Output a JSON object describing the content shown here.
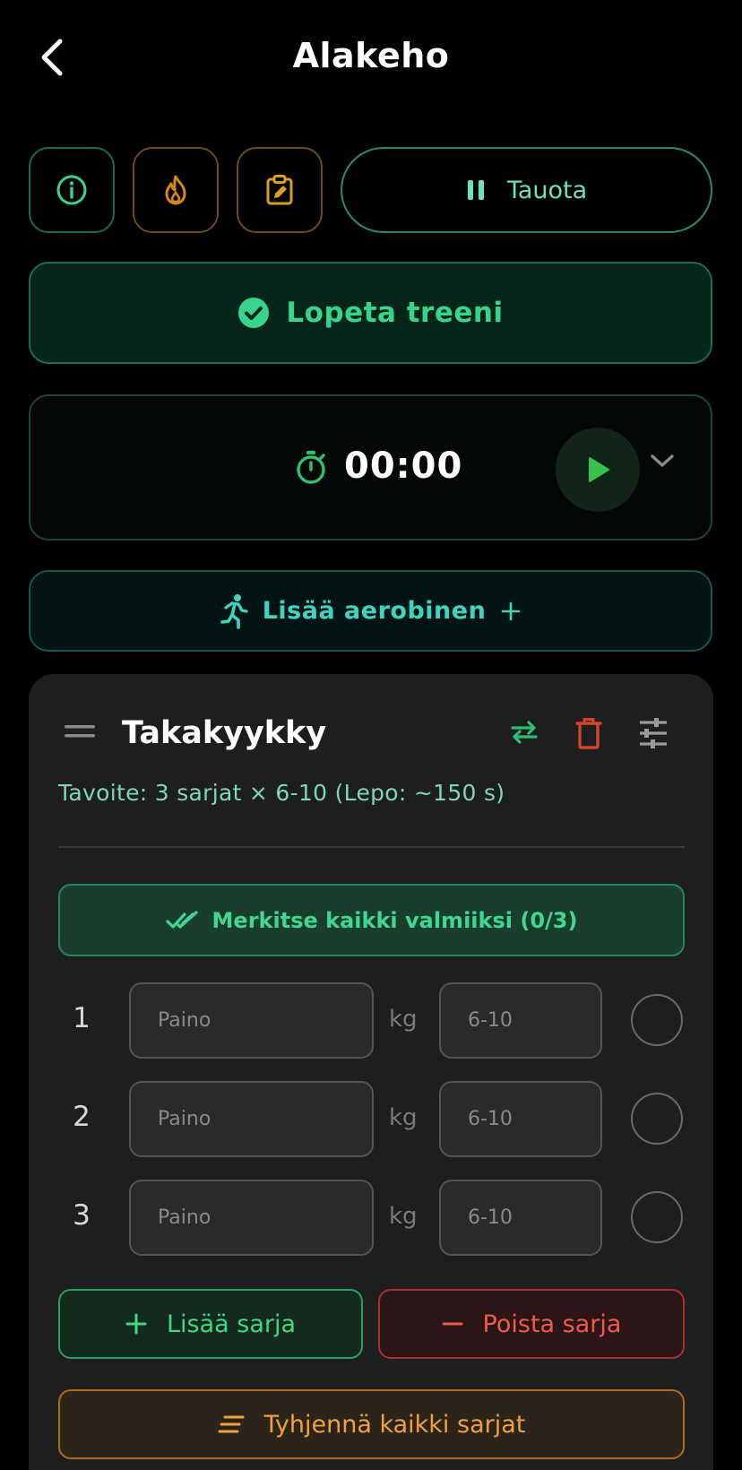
{
  "header": {
    "title": "Alakeho",
    "back_icon": "chevron-left-icon"
  },
  "toolbar": {
    "info_icon": "info-icon",
    "fire_icon": "flame-icon",
    "notes_icon": "clipboard-edit-icon",
    "pause_label": "Tauota"
  },
  "finish": {
    "label": "Lopeta treeni"
  },
  "timer": {
    "value": "00:00"
  },
  "aerobic": {
    "label": "Lisää aerobinen"
  },
  "exercise": {
    "name": "Takakyykky",
    "target": "Tavoite: 3 sarjat × 6-10 (Lepo: ~150 s)",
    "mark_all_label": "Merkitse kaikki valmiiksi (0/3)",
    "weight_unit": "kg",
    "sets": [
      {
        "number": "1",
        "weight_placeholder": "Paino",
        "reps_placeholder": "6-10"
      },
      {
        "number": "2",
        "weight_placeholder": "Paino",
        "reps_placeholder": "6-10"
      },
      {
        "number": "3",
        "weight_placeholder": "Paino",
        "reps_placeholder": "6-10"
      }
    ],
    "add_set_label": "Lisää sarja",
    "remove_set_label": "Poista sarja",
    "clear_all_label": "Tyhjennä kaikki sarjat"
  },
  "colors": {
    "accent_green": "#36d48c",
    "accent_teal": "#40d4c0",
    "accent_orange": "#f0a040",
    "danger_red": "#f05a48",
    "card_bg": "#1e1e1e"
  }
}
